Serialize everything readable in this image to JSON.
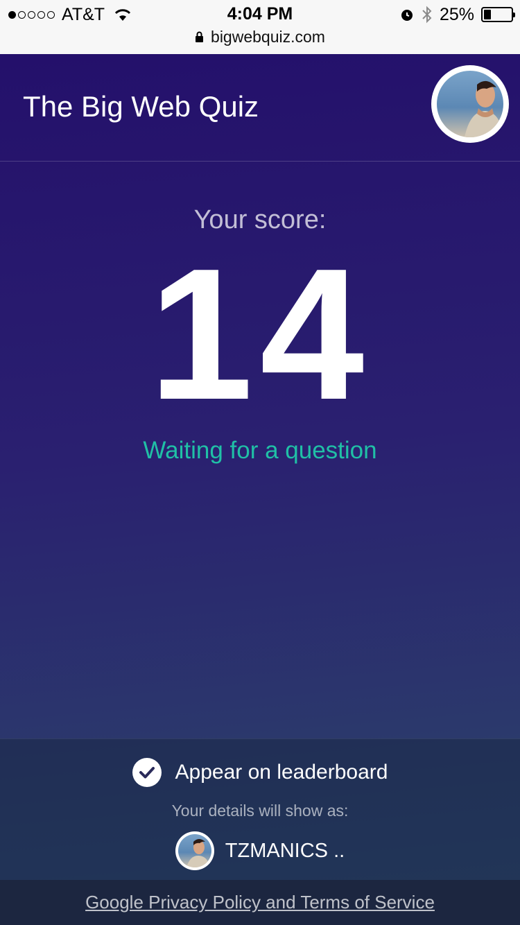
{
  "status_bar": {
    "carrier": "AT&T",
    "signal_bars": 1,
    "time": "4:04 PM",
    "battery_pct": "25%",
    "url": "bigwebquiz.com"
  },
  "header": {
    "title": "The Big Web Quiz",
    "avatar_icon": "user-photo"
  },
  "main": {
    "score_label": "Your score:",
    "score": "14",
    "status": "Waiting for a question",
    "status_color": "#20c0a6"
  },
  "footer": {
    "leaderboard_label": "Appear on leaderboard",
    "leaderboard_checked": true,
    "details_label": "Your details will show as:",
    "display_name": "TZMANICS .."
  },
  "legal": {
    "link_text": "Google Privacy Policy and Terms of Service"
  }
}
